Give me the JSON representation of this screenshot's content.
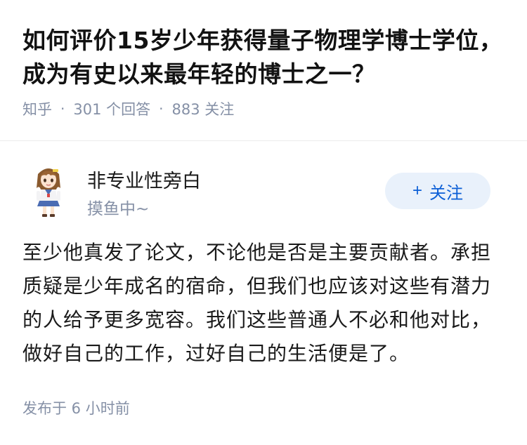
{
  "question": {
    "title": "如何评价15岁少年获得量子物理学博士学位，成为有史以来最年轻的博士之一？",
    "source": "知乎",
    "separator": "·",
    "answers_count": "301",
    "answers_label": "个回答",
    "followers_count": "883",
    "followers_label": "关注"
  },
  "author": {
    "name": "非专业性旁白",
    "bio": "摸鱼中~",
    "avatar_icon": "anime-girl-avatar",
    "follow_button": {
      "plus": "+",
      "label": "关注"
    }
  },
  "answer": {
    "content": "至少他真发了论文，不论他是否是主要贡献者。承担质疑是少年成名的宿命，但我们也应该对这些有潜力的人给予更多宽容。我们这些普通人不必和他对比，做好自己的工作，过好自己的生活便是了。",
    "published": "发布于 6 小时前"
  },
  "colors": {
    "accent": "#0c5fd6",
    "button_bg": "#e9f1fb",
    "meta_gray": "#8590a6",
    "text": "#1a1a1a"
  }
}
